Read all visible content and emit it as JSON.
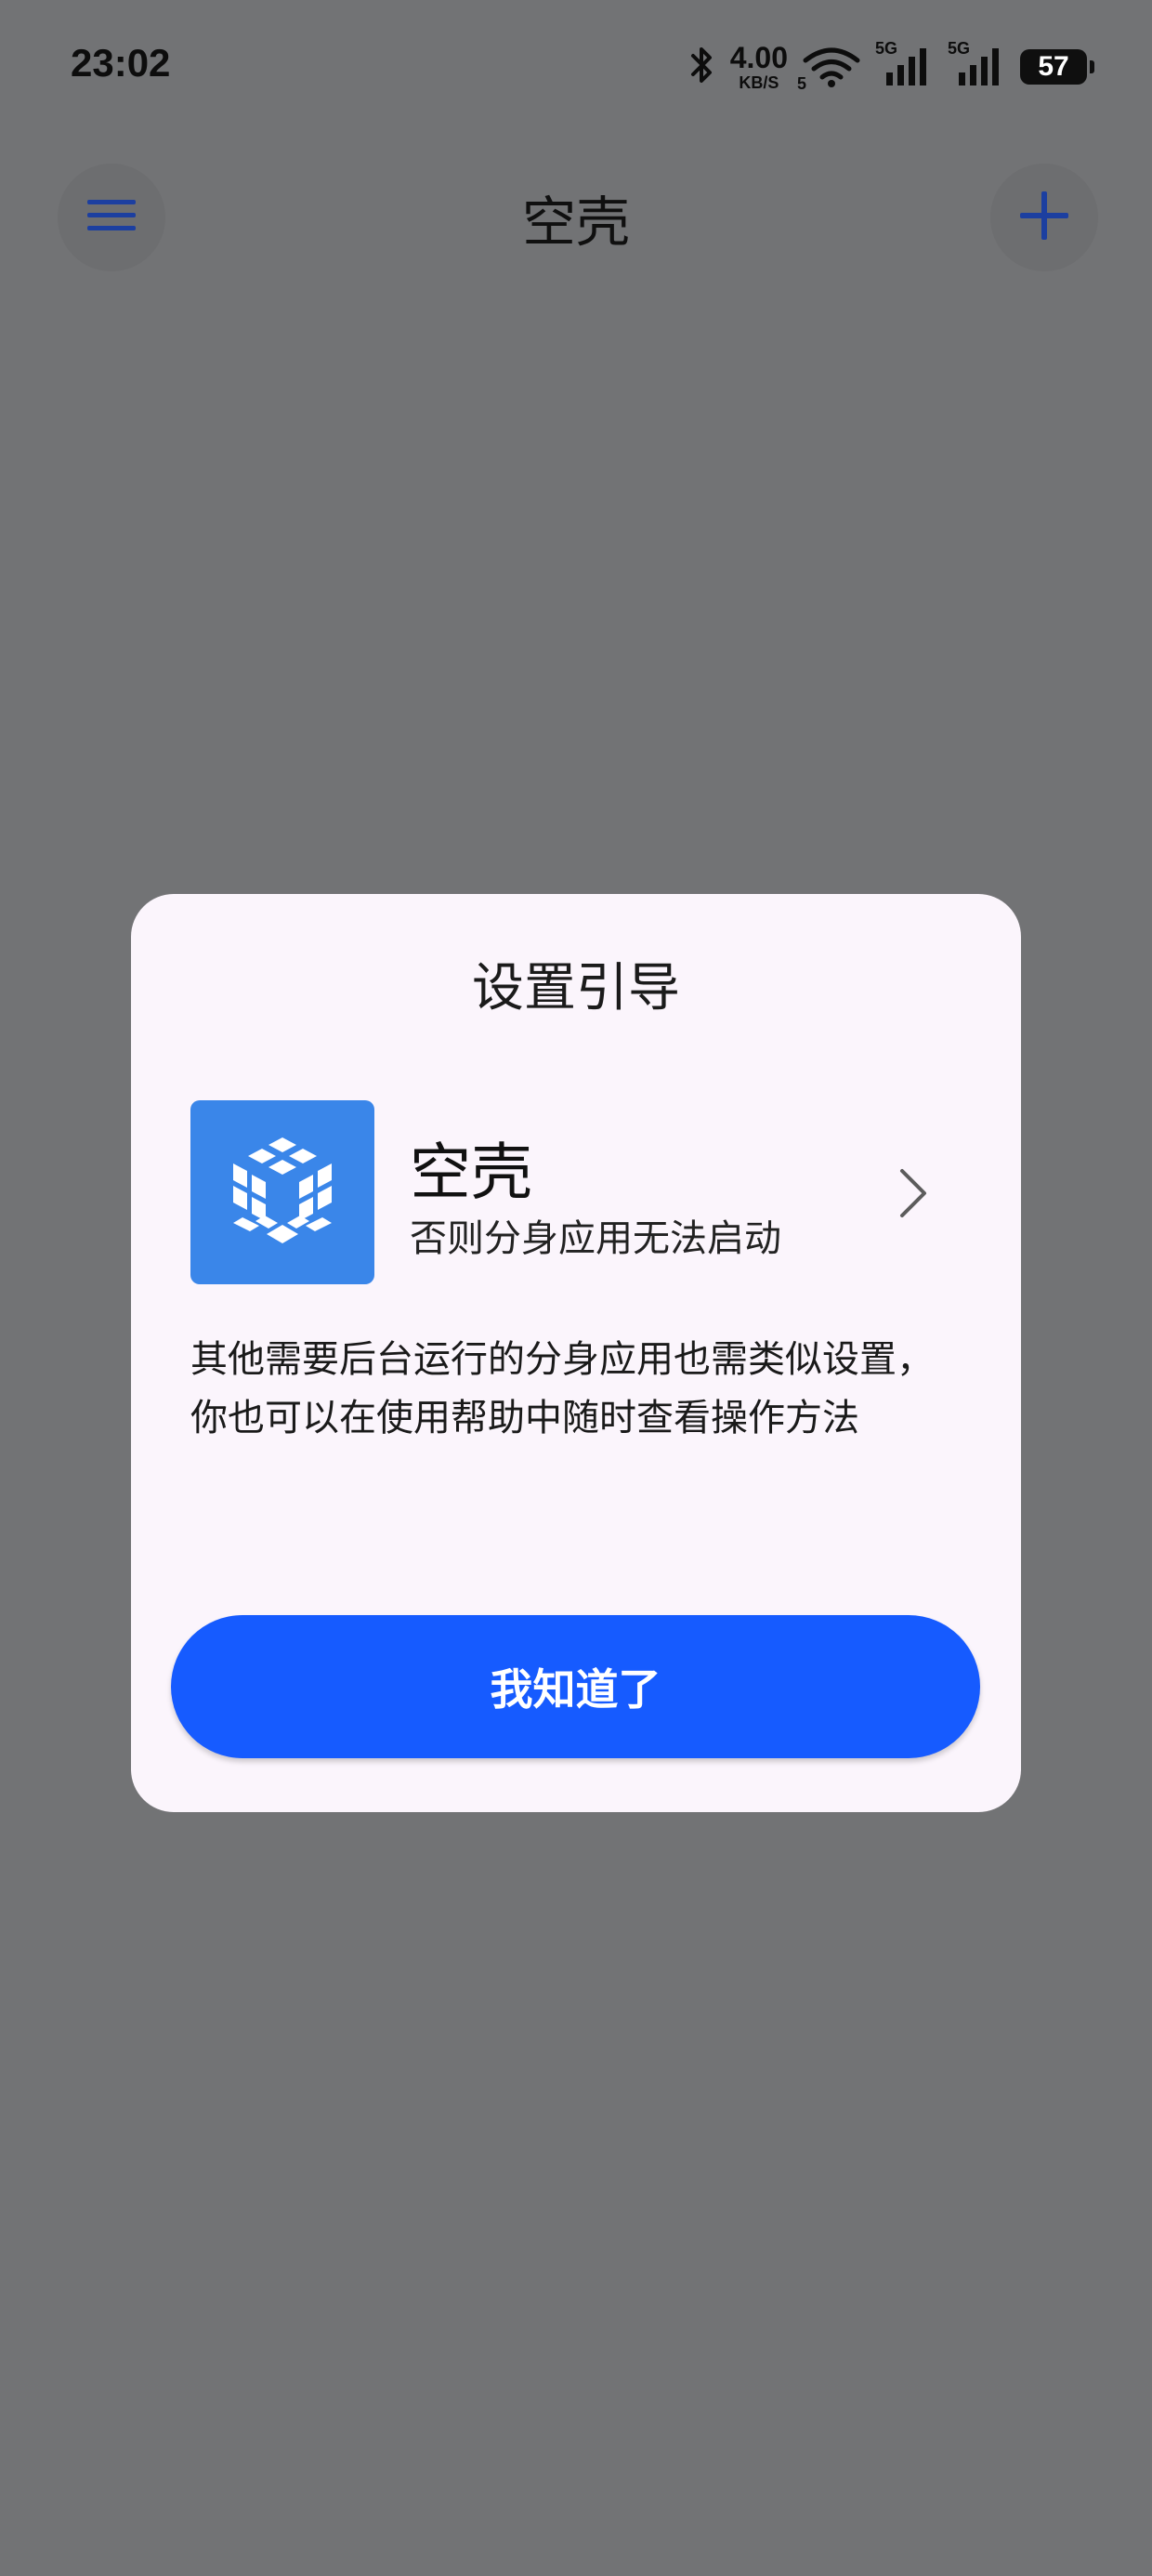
{
  "status_bar": {
    "time": "23:02",
    "net_speed_value": "4.00",
    "net_speed_unit": "KB/S",
    "wifi_badge": "5",
    "signal1_label": "5G",
    "signal2_label": "5G",
    "battery": "57",
    "icons": [
      "bluetooth-icon",
      "wifi-icon",
      "signal-icon",
      "signal-icon",
      "battery-icon"
    ]
  },
  "header": {
    "title": "空壳",
    "menu_icon": "menu-icon",
    "add_icon": "plus-icon"
  },
  "dialog": {
    "title": "设置引导",
    "app_name": "空壳",
    "app_subtitle": "否则分身应用无法启动",
    "description": "其他需要后台运行的分身应用也需类似设置，你也可以在使用帮助中随时查看操作方法",
    "confirm_label": "我知道了"
  },
  "colors": {
    "scrim": "#727375",
    "dialog_bg": "#fbf5fc",
    "primary": "#165bff",
    "app_icon_bg": "#3a86e9",
    "header_icon": "#1c3fa0"
  }
}
